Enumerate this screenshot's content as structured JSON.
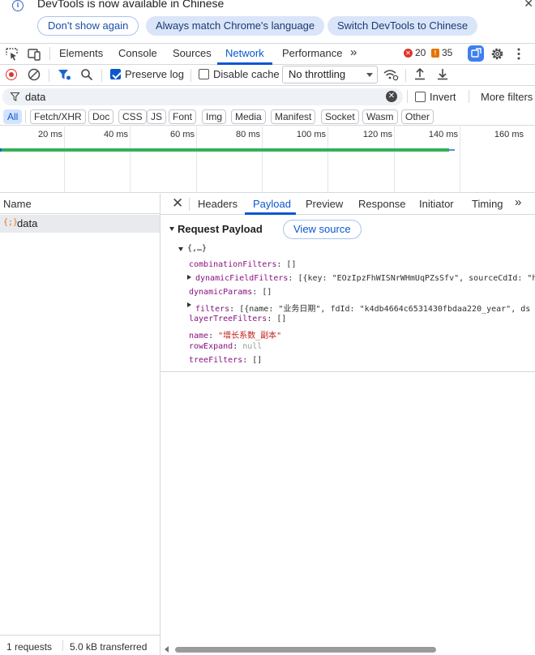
{
  "infobar": {
    "message": "DevTools is now available in Chinese",
    "dont_show": "Don't show again",
    "match_language": "Always match Chrome's language",
    "switch_language": "Switch DevTools to Chinese"
  },
  "main_tabs": {
    "items": [
      "Elements",
      "Console",
      "Sources",
      "Network",
      "Performance"
    ],
    "active": "Network",
    "more": "»",
    "errors": "20",
    "warnings": "35"
  },
  "network_toolbar": {
    "preserve_log": "Preserve log",
    "preserve_log_checked": true,
    "disable_cache": "Disable cache",
    "disable_cache_checked": false,
    "throttling": "No throttling"
  },
  "filter": {
    "value": "data",
    "invert": "Invert",
    "more_filters": "More filters"
  },
  "type_filters": [
    "All",
    "Fetch/XHR",
    "Doc",
    "CSS",
    "JS",
    "Font",
    "Img",
    "Media",
    "Manifest",
    "Socket",
    "Wasm",
    "Other"
  ],
  "active_type": "All",
  "timeline": {
    "ticks": [
      "20 ms",
      "40 ms",
      "60 ms",
      "80 ms",
      "100 ms",
      "120 ms",
      "140 ms",
      "160 ms"
    ]
  },
  "request_list": {
    "column": "Name",
    "items": [
      {
        "name": "data",
        "icon": "json-icon"
      }
    ]
  },
  "status": {
    "requests": "1 requests",
    "transferred": "5.0 kB transferred"
  },
  "detail_tabs": {
    "items": [
      "Headers",
      "Payload",
      "Preview",
      "Response",
      "Initiator",
      "Timing"
    ],
    "active": "Payload",
    "more": "»"
  },
  "payload": {
    "title": "Request Payload",
    "view_source": "View source",
    "root": "{,…}",
    "fields": [
      {
        "key": "combinationFilters",
        "value": "[]",
        "expandable": false,
        "type": "punc"
      },
      {
        "key": "dynamicFieldFilters",
        "value": "[{key: \"EOzIpzFhWISNrWHmUqPZsSfv\", sourceCdId: \"h",
        "expandable": true,
        "type": "punc"
      },
      {
        "key": "dynamicParams",
        "value": "[]",
        "expandable": false,
        "type": "punc"
      },
      {
        "key": "filters",
        "value": "[{name: \"业务日期\", fdId: \"k4db4664c6531430fbdaa220_year\", ds",
        "expandable": true,
        "type": "punc"
      },
      {
        "key": "layerTreeFilters",
        "value": "[]",
        "expandable": false,
        "type": "punc"
      },
      {
        "key": "name",
        "value": "\"增长系数_副本\"",
        "expandable": false,
        "type": "str"
      },
      {
        "key": "rowExpand",
        "value": "null",
        "expandable": false,
        "type": "nul"
      },
      {
        "key": "treeFilters",
        "value": "[]",
        "expandable": false,
        "type": "punc"
      }
    ]
  },
  "colors": {
    "accent": "#0b57d0",
    "error": "#dc362e",
    "warning": "#e37400",
    "waterfall": "#33b05a"
  }
}
